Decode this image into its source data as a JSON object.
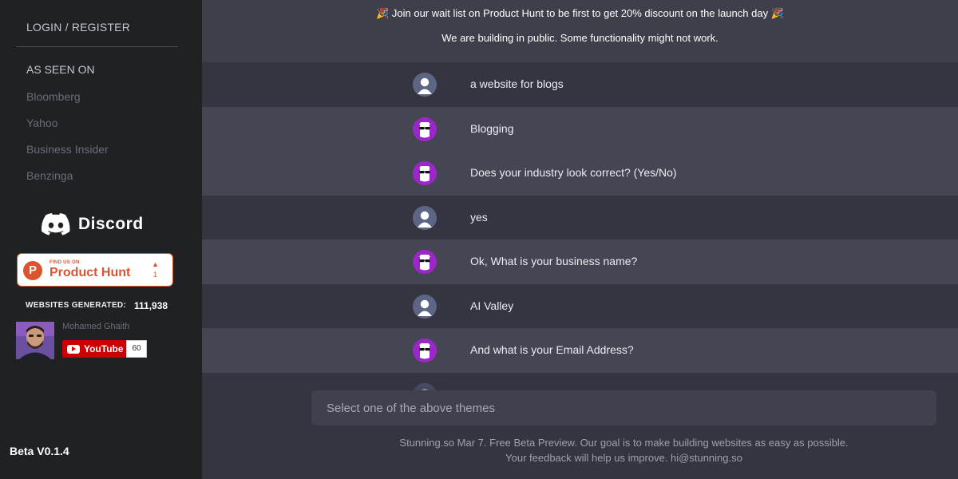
{
  "sidebar": {
    "login_label": "LOGIN / REGISTER",
    "seen_title": "AS SEEN ON",
    "seen_items": [
      "Bloomberg",
      "Yahoo",
      "Business Insider",
      "Benzinga"
    ],
    "discord_label": "Discord",
    "product_hunt": {
      "small_label": "FIND US ON",
      "big_label": "Product Hunt",
      "letter": "P",
      "upvote_arrow": "▲",
      "upvotes": "1"
    },
    "websites_generated_label": "WEBSITES GENERATED:",
    "websites_generated_value": "111,938",
    "youtube": {
      "channel_name": "Mohamed Ghaith",
      "button_label": "YouTube",
      "subscriber_count": "60"
    },
    "version": "Beta V0.1.4"
  },
  "banner": {
    "line1": "🎉 Join our wait list on Product Hunt to be first to get 20% discount on the launch day 🎉",
    "line2": "We are building in public. Some functionality might not work."
  },
  "messages": [
    {
      "role": "user",
      "text": "a website for blogs"
    },
    {
      "role": "bot",
      "text": "Blogging"
    },
    {
      "role": "bot",
      "text": "Does your industry look correct? (Yes/No)"
    },
    {
      "role": "user",
      "text": "yes"
    },
    {
      "role": "bot",
      "text": "Ok, What is your business name?"
    },
    {
      "role": "user",
      "text": "AI Valley"
    },
    {
      "role": "bot",
      "text": "And what is your Email Address?"
    }
  ],
  "input": {
    "placeholder": "Select one of the above themes"
  },
  "footer": {
    "line1": "Stunning.so Mar 7. Free Beta Preview. Our goal is to make building websites as easy as possible.",
    "line2": "Your feedback will help us improve. hi@stunning.so"
  },
  "colors": {
    "sidebar_bg": "#202123",
    "main_bg": "#343541",
    "bot_row_bg": "#444654",
    "bot_avatar": "#9b27c9",
    "user_avatar": "#586080",
    "product_hunt_orange": "#da552f",
    "youtube_red": "#cc0000"
  }
}
